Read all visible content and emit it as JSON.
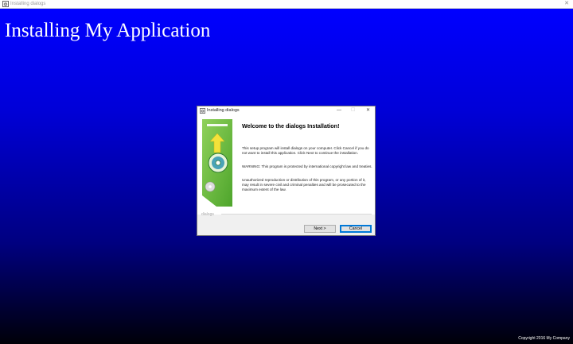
{
  "outer_window": {
    "title": "Installing dialogs",
    "close_glyph": "✕"
  },
  "backdrop": {
    "title": "Installing My Application",
    "copyright": "Copyright 2016 My Company"
  },
  "dialog": {
    "title": "Installing dialogs",
    "controls": {
      "minimize": "—",
      "maximize": "☐",
      "close": "✕"
    },
    "heading": "Welcome to the dialogs Installation!",
    "paragraphs": [
      "This setup program will install dialogs on your computer. Click Cancel if you do not want to install this application. Click Next to continue the installation.",
      "WARNING: This program is protected by international copyright law and treaties.",
      "Unauthorized reproduction or distribution of this program, or any portion of it, may result in severe civil and criminal penalties and will be prosecuted to the maximum extent of the law."
    ],
    "brand": "dialogs",
    "buttons": {
      "next": "Next >",
      "cancel": "Cancel"
    }
  },
  "colors": {
    "backdrop_top": "#0000ff",
    "backdrop_bottom": "#000008",
    "banner_green": "#6ebf3a",
    "default_button_border": "#0078d7"
  },
  "icons": [
    "installer-app-icon",
    "installer-banner-cd-icon"
  ]
}
